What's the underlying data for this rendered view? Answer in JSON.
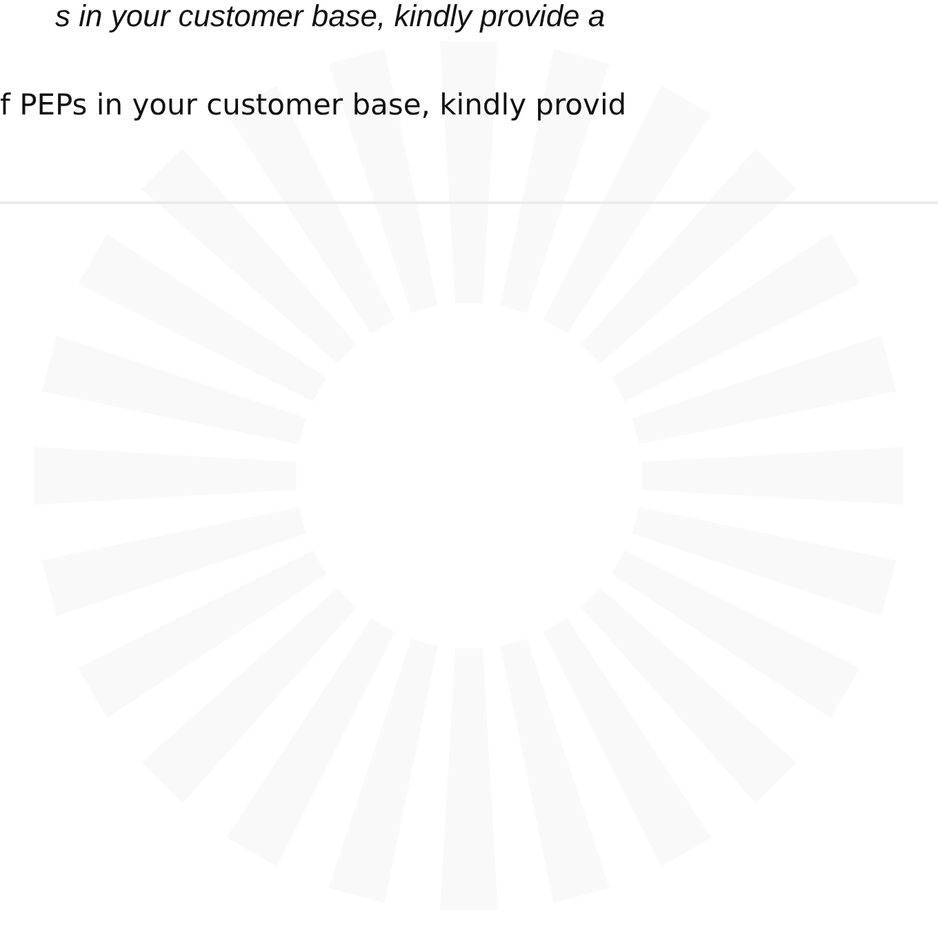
{
  "lines": [
    {
      "kind": "italic",
      "text": "s in your customer base, kindly provide a"
    },
    {
      "kind": "plain",
      "text": "f PEPs in your customer base, kindly provid"
    }
  ],
  "loading": true
}
